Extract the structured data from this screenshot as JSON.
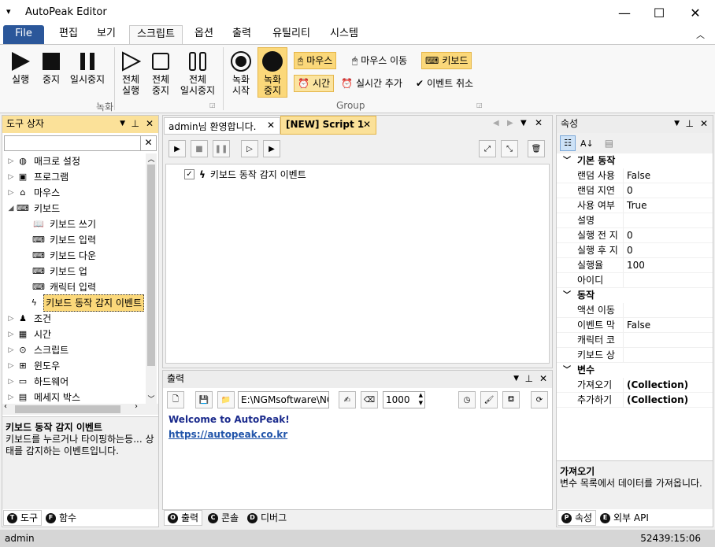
{
  "window": {
    "title": "AutoPeak Editor",
    "minimize": "—",
    "maximize": "☐",
    "close": "✕",
    "menu_glyph": "▾"
  },
  "ribbon_tabs": [
    {
      "label": "File"
    },
    {
      "label": "편집"
    },
    {
      "label": "보기"
    },
    {
      "label": "스크립트"
    },
    {
      "label": "옵션"
    },
    {
      "label": "출력"
    },
    {
      "label": "유틸리티"
    },
    {
      "label": "시스템"
    }
  ],
  "ribbon": {
    "run": "실행",
    "stop": "중지",
    "pause": "일시중지",
    "run_all": [
      "전체",
      "실행"
    ],
    "stop_all": [
      "전체",
      "중지"
    ],
    "pause_all": [
      "전체",
      "일시중지"
    ],
    "record_start": [
      "녹화",
      "시작"
    ],
    "record_stop": [
      "녹화",
      "중지"
    ],
    "group_record": "녹화",
    "group_group": "Group",
    "mouse": "마우스",
    "mouse_move": "마우스 이동",
    "keyboard": "키보드",
    "time": "시간",
    "realtime_add": "실시간 추가",
    "event_cancel": "이벤트 취소"
  },
  "toolbox": {
    "title": "도구 상자",
    "search_value": "",
    "items": [
      {
        "label": "매크로 설정",
        "indent": 0,
        "arrow": "▷"
      },
      {
        "label": "프로그램",
        "indent": 0,
        "arrow": "▷"
      },
      {
        "label": "마우스",
        "indent": 0,
        "arrow": "▷"
      },
      {
        "label": "키보드",
        "indent": 0,
        "arrow": "◢"
      },
      {
        "label": "키보드 쓰기",
        "indent": 1,
        "arrow": ""
      },
      {
        "label": "키보드 입력",
        "indent": 1,
        "arrow": ""
      },
      {
        "label": "키보드 다운",
        "indent": 1,
        "arrow": ""
      },
      {
        "label": "키보드 업",
        "indent": 1,
        "arrow": ""
      },
      {
        "label": "캐릭터 입력",
        "indent": 1,
        "arrow": ""
      },
      {
        "label": "키보드 동작 감지 이벤트",
        "indent": 1,
        "arrow": "",
        "selected": true
      },
      {
        "label": "조건",
        "indent": 0,
        "arrow": "▷"
      },
      {
        "label": "시간",
        "indent": 0,
        "arrow": "▷"
      },
      {
        "label": "스크립트",
        "indent": 0,
        "arrow": "▷"
      },
      {
        "label": "윈도우",
        "indent": 0,
        "arrow": "▷"
      },
      {
        "label": "하드웨어",
        "indent": 0,
        "arrow": "▷"
      },
      {
        "label": "메세지 박스",
        "indent": 0,
        "arrow": "▷"
      }
    ],
    "desc_title": "키보드 동작 감지 이벤트",
    "desc_text": "키보드를 누르거나 타이핑하는등... 상태를 감지하는 이벤트입니다.",
    "bottom_tabs": [
      {
        "icon": "T",
        "label": "도구"
      },
      {
        "icon": "F",
        "label": "함수"
      }
    ]
  },
  "editor": {
    "tabs": [
      {
        "label": "admin님 환영합니다."
      },
      {
        "label": "[NEW] Script 1"
      }
    ],
    "script_item": "키보드 동작 감지 이벤트"
  },
  "output": {
    "title": "출력",
    "path": "E:\\NGMsoftware\\NG",
    "number": "1000",
    "welcome": "Welcome to AutoPeak!",
    "link": "https://autopeak.co.kr",
    "bottom_tabs": [
      {
        "icon": "O",
        "label": "출력"
      },
      {
        "icon": "C",
        "label": "콘솔"
      },
      {
        "icon": "D",
        "label": "디버그"
      }
    ]
  },
  "properties": {
    "title": "속성",
    "categories": [
      {
        "name": "기본 동작",
        "rows": [
          {
            "k": "랜덤 사용",
            "v": "False"
          },
          {
            "k": "랜덤 지연",
            "v": "0"
          },
          {
            "k": "사용 여부",
            "v": "True"
          },
          {
            "k": "설명",
            "v": ""
          },
          {
            "k": "실행 전 지",
            "v": "0"
          },
          {
            "k": "실행 후 지",
            "v": "0"
          },
          {
            "k": "실행율",
            "v": "100"
          },
          {
            "k": "아이디",
            "v": ""
          }
        ]
      },
      {
        "name": "동작",
        "rows": [
          {
            "k": "액션 이동",
            "v": ""
          },
          {
            "k": "이벤트 막",
            "v": "False"
          },
          {
            "k": "캐릭터 코",
            "v": ""
          },
          {
            "k": "키보드 상",
            "v": ""
          }
        ]
      },
      {
        "name": "변수",
        "rows": [
          {
            "k": "가져오기",
            "v": "(Collection)",
            "bold": true
          },
          {
            "k": "추가하기",
            "v": "(Collection)",
            "bold": true
          }
        ]
      }
    ],
    "desc_title": "가져오기",
    "desc_text": "변수 목록에서 데이터를 가져옵니다.",
    "bottom_tabs": [
      {
        "icon": "P",
        "label": "속성"
      },
      {
        "icon": "E",
        "label": "외부 API"
      }
    ]
  },
  "status": {
    "user": "admin",
    "time": "52439:15:06"
  }
}
